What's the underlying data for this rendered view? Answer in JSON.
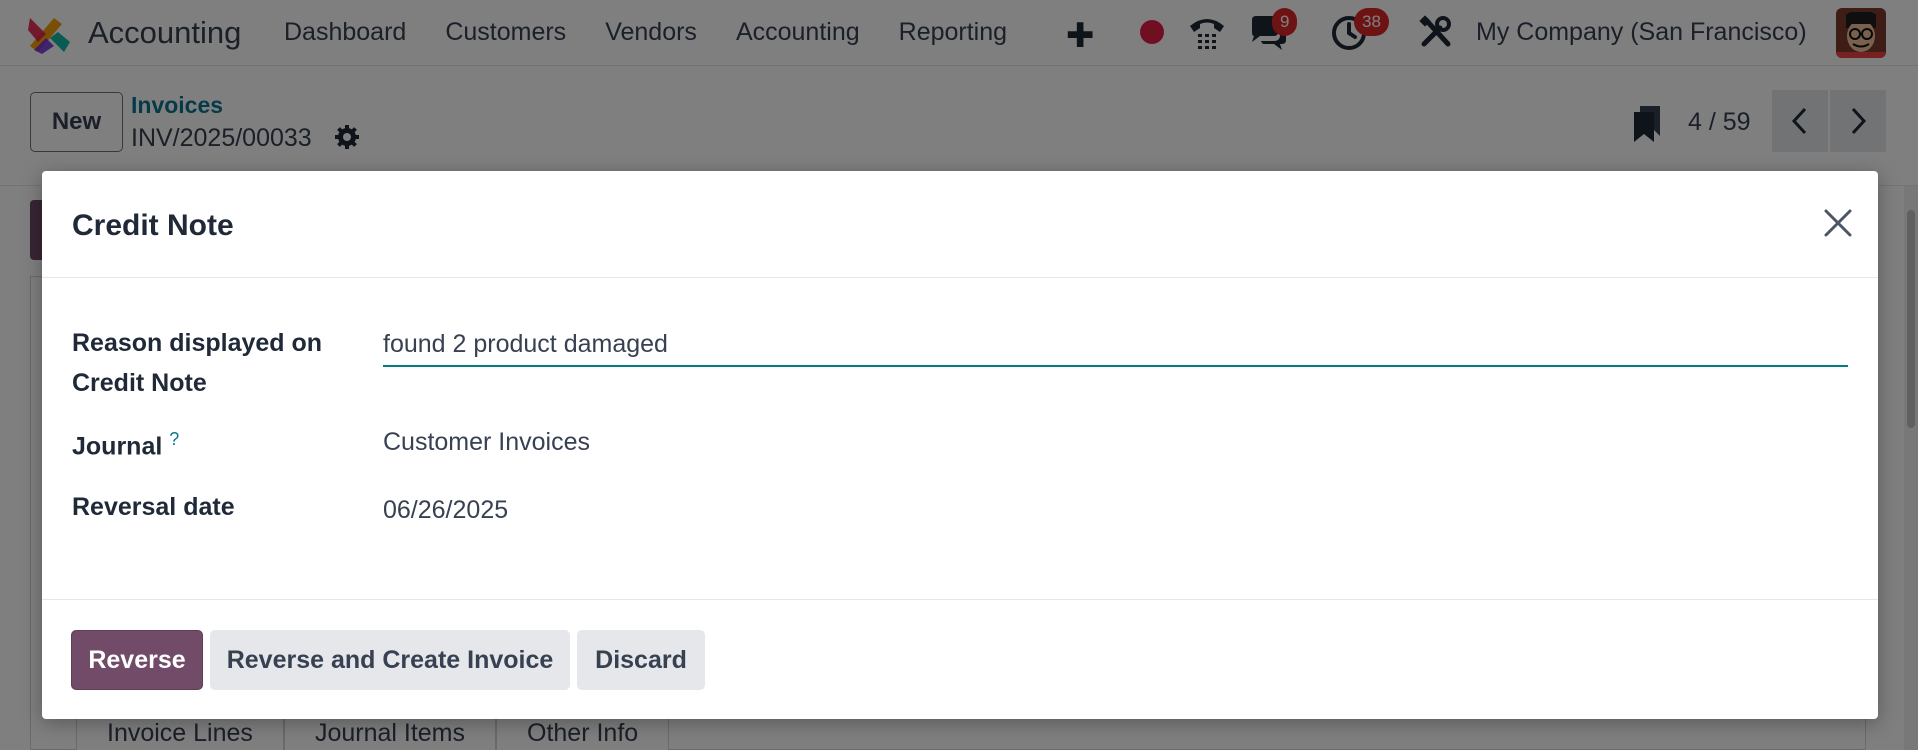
{
  "navbar": {
    "app_name": "Accounting",
    "menu": [
      "Dashboard",
      "Customers",
      "Vendors",
      "Accounting",
      "Reporting"
    ],
    "chat_badge": "9",
    "activity_badge": "38",
    "company": "My Company (San Francisco)"
  },
  "control_panel": {
    "new_label": "New",
    "breadcrumb": "Invoices",
    "record_name": "INV/2025/00033",
    "pager": "4 / 59"
  },
  "background": {
    "tabs": [
      "Invoice Lines",
      "Journal Items",
      "Other Info"
    ]
  },
  "dialog": {
    "title": "Credit Note",
    "reason_label": "Reason displayed on Credit Note",
    "reason_value": "found 2 product damaged",
    "journal_label": "Journal",
    "journal_help": "?",
    "journal_value": "Customer Invoices",
    "date_label": "Reversal date",
    "date_value": "06/26/2025",
    "buttons": {
      "reverse": "Reverse",
      "reverse_create": "Reverse and Create Invoice",
      "discard": "Discard"
    }
  },
  "colors": {
    "primary": "#714b67",
    "accent": "#017e84",
    "badge": "#dc2626"
  }
}
